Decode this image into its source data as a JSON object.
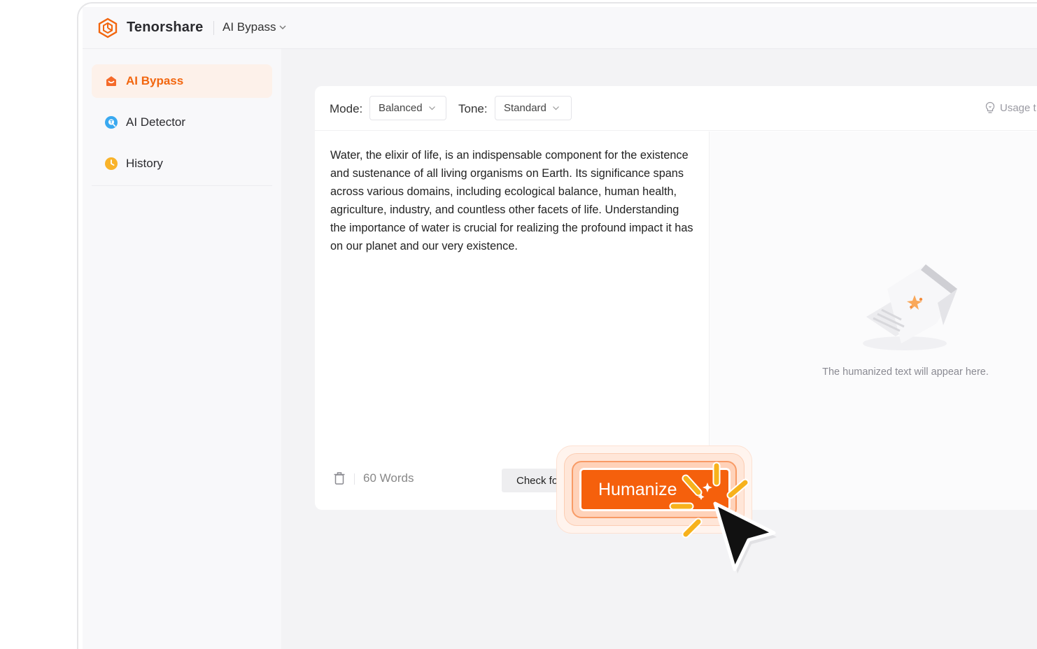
{
  "header": {
    "brand": "Tenorshare",
    "product": "AI Bypass"
  },
  "sidebar": {
    "items": [
      {
        "label": "AI Bypass",
        "icon": "bypass-icon",
        "active": true
      },
      {
        "label": "AI Detector",
        "icon": "detector-icon",
        "active": false
      },
      {
        "label": "History",
        "icon": "clock-icon",
        "active": false
      }
    ]
  },
  "toolbar": {
    "mode_label": "Mode:",
    "mode_value": "Balanced",
    "tone_label": "Tone:",
    "tone_value": "Standard",
    "usage_text": "Usage t"
  },
  "editor": {
    "input_text": "Water, the elixir of life, is an indispensable component for the existence and sustenance of all living organisms on Earth. Its significance spans across various domains, including ecological balance, human health, agriculture, industry, and countless other facets of life. Understanding the importance of water is crucial for realizing the profound impact it has on our planet and our very existence.",
    "word_count": "60 Words",
    "check_label": "Check for AI",
    "humanize_label": "Humanize",
    "output_placeholder": "The humanized text will appear here."
  },
  "colors": {
    "accent": "#f5600c",
    "active_bg": "#fdf1ea",
    "sparkle": "#f7b21c"
  }
}
